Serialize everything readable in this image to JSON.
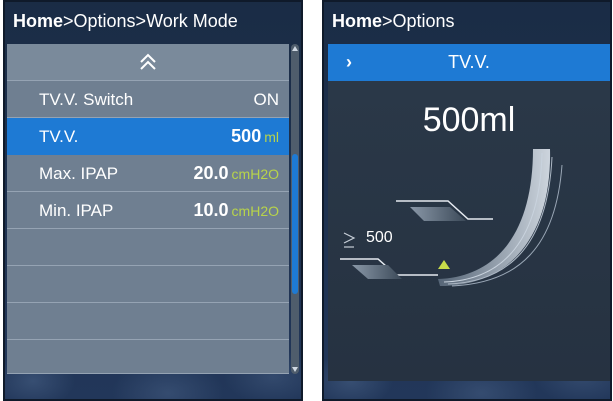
{
  "left_screen": {
    "breadcrumb": {
      "home": "Home",
      "path": ">Options>Work Mode"
    },
    "rows": [
      {
        "label": "TV.V. Switch",
        "value": "ON",
        "unit": ""
      },
      {
        "label": "TV.V.",
        "value": "500",
        "unit": "ml"
      },
      {
        "label": "Max. IPAP",
        "value": "20.0",
        "unit": "cmH2O"
      },
      {
        "label": "Min. IPAP",
        "value": "10.0",
        "unit": "cmH2O"
      }
    ]
  },
  "right_screen": {
    "breadcrumb": {
      "home": "Home",
      "path": ">Options"
    },
    "title": "TV.V.",
    "title_arrow": "›",
    "big_value": "500ml",
    "small_label": "500"
  },
  "colors": {
    "accent": "#1e7ad4",
    "unit_green": "#b8d44a",
    "row_bg": "#6f7f91",
    "screen_bg": "#1d2f47"
  },
  "icons": {
    "scroll_up": "double-chevron-up-icon",
    "threshold_marker": "triangle-marker-icon",
    "small_value_icon": "greater-equal-icon"
  }
}
